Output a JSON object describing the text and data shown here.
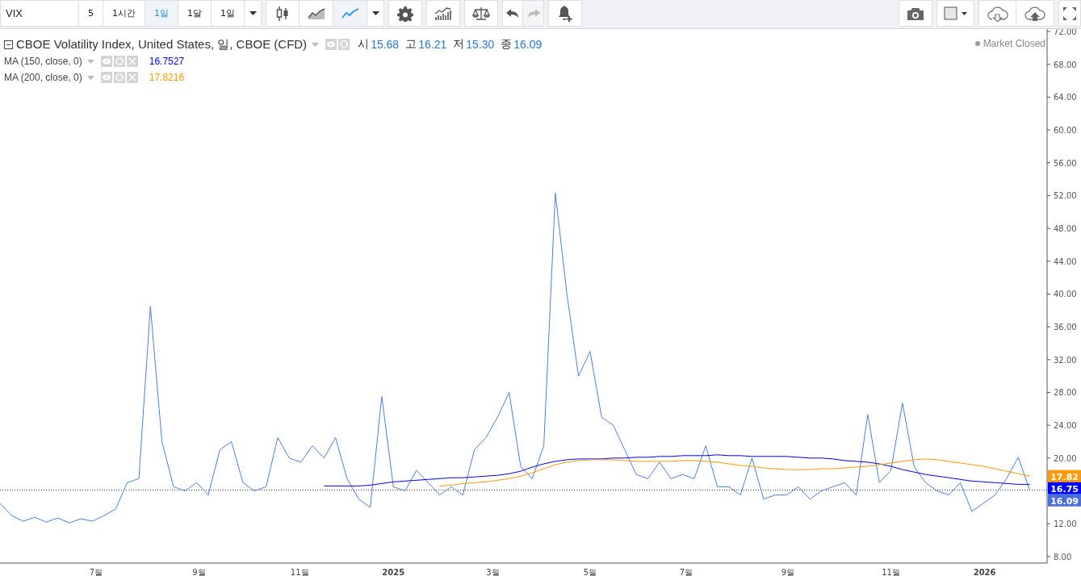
{
  "toolbar": {
    "intervals": [
      {
        "label": "5",
        "selected": false
      },
      {
        "label": "1시간",
        "selected": false
      },
      {
        "label": "1일",
        "selected": true
      },
      {
        "label": "1달",
        "selected": false
      },
      {
        "label": "1일",
        "selected": false
      }
    ],
    "chart_types": [
      {
        "kind": "candles",
        "selected": false
      },
      {
        "kind": "area",
        "selected": false
      },
      {
        "kind": "line",
        "selected": true
      }
    ],
    "undo": {
      "disabled": false
    },
    "redo": {
      "disabled": true
    }
  },
  "legend": {
    "title": "CBOE Volatility Index, United States, 일, CBOE (CFD)",
    "ohlc": [
      {
        "label": "시",
        "value": "15.68"
      },
      {
        "label": "고",
        "value": "16.21"
      },
      {
        "label": "저",
        "value": "15.30"
      },
      {
        "label": "종",
        "value": "16.09"
      }
    ],
    "indicators": [
      {
        "value": "16.7527",
        "color": "#0000ff"
      },
      {
        "value": "17.8216",
        "color": "#ff9800"
      }
    ]
  },
  "market_status": "Market Closed",
  "price_labels": [
    {
      "text": "17.82",
      "color": "#ff9800"
    },
    {
      "text": "16.75",
      "color": "#0000ff"
    },
    {
      "text": "16.09",
      "color": "#4a6fdf"
    }
  ],
  "x_axis": [
    {
      "label": "7월",
      "bold": false
    },
    {
      "label": "9월",
      "bold": false
    },
    {
      "label": "11월",
      "bold": false
    },
    {
      "label": "2025",
      "bold": true
    },
    {
      "label": "3월",
      "bold": false
    },
    {
      "label": "5월",
      "bold": false
    },
    {
      "label": "7월",
      "bold": false
    },
    {
      "label": "9월",
      "bold": false
    },
    {
      "label": "11월",
      "bold": false
    },
    {
      "label": "2026",
      "bold": true
    }
  ],
  "chart_data": {
    "type": "line",
    "ylim": [
      7.2,
      72.3
    ],
    "ref_lines": [
      {
        "axis": "y",
        "value": 16.1
      }
    ],
    "yticks": [
      {
        "value": 8,
        "label": "8.00"
      },
      {
        "value": 12,
        "label": "12.00"
      },
      {
        "value": 20,
        "label": "20.00"
      },
      {
        "value": 24,
        "label": "24.00"
      },
      {
        "value": 28,
        "label": "28.00"
      },
      {
        "value": 32,
        "label": "32.00"
      },
      {
        "value": 36,
        "label": "36.00"
      },
      {
        "value": 40,
        "label": "40.00"
      },
      {
        "value": 44,
        "label": "44.00"
      },
      {
        "value": 48,
        "label": "48.00"
      },
      {
        "value": 52,
        "label": "52.00"
      },
      {
        "value": 56,
        "label": "56.00"
      },
      {
        "value": 60,
        "label": "60.00"
      },
      {
        "value": 64,
        "label": "64.00"
      },
      {
        "value": 68,
        "label": "68.00"
      },
      {
        "value": 72,
        "label": "72.00"
      }
    ],
    "series": [
      {
        "name": "VIX",
        "color": "#4a7fe0",
        "values": [
          14.5,
          13.0,
          12.3,
          12.8,
          12.2,
          12.7,
          12.1,
          12.6,
          12.3,
          13.0,
          13.8,
          17.0,
          17.5,
          38.5,
          22,
          16.5,
          16,
          17,
          15.5,
          21,
          22,
          17,
          16,
          16.5,
          22.5,
          20,
          19.5,
          21.5,
          20,
          22.5,
          17.5,
          15,
          14,
          27.5,
          16.5,
          16,
          18.5,
          17,
          15.5,
          16.5,
          15.5,
          21,
          22.5,
          25,
          28,
          19,
          17.5,
          21.5,
          52.3,
          40,
          30,
          33,
          25,
          24,
          21,
          18,
          17.5,
          19.5,
          17.5,
          18,
          17.5,
          21.5,
          16.5,
          16.5,
          15.5,
          20,
          15,
          15.5,
          15.5,
          16.5,
          15,
          16,
          16.5,
          17,
          15.5,
          25.3,
          17,
          18.5,
          26.7,
          19,
          17,
          16,
          15.5,
          17,
          13.5,
          14.5,
          15.5,
          17.5,
          20.1,
          16.1
        ]
      },
      {
        "name": "MA (150, close, 0)",
        "color": "#0000ff",
        "values": [
          null,
          null,
          null,
          null,
          null,
          null,
          null,
          null,
          null,
          null,
          null,
          null,
          null,
          null,
          null,
          null,
          null,
          null,
          null,
          null,
          null,
          null,
          null,
          null,
          null,
          null,
          null,
          null,
          16.6,
          16.6,
          16.6,
          16.6,
          16.7,
          16.9,
          17.1,
          17.2,
          17.3,
          17.4,
          17.5,
          17.6,
          17.6,
          17.7,
          17.8,
          17.9,
          18.1,
          18.4,
          18.9,
          19.3,
          19.6,
          19.8,
          19.9,
          19.9,
          19.9,
          20.0,
          20.0,
          20.1,
          20.1,
          20.2,
          20.2,
          20.3,
          20.3,
          20.3,
          20.4,
          20.3,
          20.3,
          20.2,
          20.2,
          20.2,
          20.2,
          20.1,
          20.0,
          20.0,
          19.9,
          19.7,
          19.6,
          19.5,
          19.3,
          19.0,
          18.6,
          18.3,
          18.0,
          17.8,
          17.6,
          17.4,
          17.2,
          17.1,
          17.0,
          16.9,
          16.8,
          16.8
        ]
      },
      {
        "name": "MA (200, close, 0)",
        "color": "#ff9800",
        "values": [
          null,
          null,
          null,
          null,
          null,
          null,
          null,
          null,
          null,
          null,
          null,
          null,
          null,
          null,
          null,
          null,
          null,
          null,
          null,
          null,
          null,
          null,
          null,
          null,
          null,
          null,
          null,
          null,
          null,
          null,
          null,
          null,
          null,
          null,
          null,
          null,
          null,
          null,
          16.6,
          16.7,
          16.9,
          17.0,
          17.1,
          17.3,
          17.5,
          17.8,
          18.2,
          18.7,
          19.2,
          19.5,
          19.7,
          19.8,
          19.8,
          19.8,
          19.7,
          19.6,
          19.6,
          19.6,
          19.6,
          19.7,
          19.7,
          19.6,
          19.5,
          19.3,
          19.1,
          19.0,
          18.8,
          18.7,
          18.6,
          18.6,
          18.6,
          18.7,
          18.7,
          18.8,
          18.9,
          19.0,
          19.2,
          19.4,
          19.6,
          19.8,
          19.9,
          19.8,
          19.6,
          19.4,
          19.2,
          19.0,
          18.7,
          18.4,
          18.1,
          17.8
        ]
      }
    ]
  }
}
